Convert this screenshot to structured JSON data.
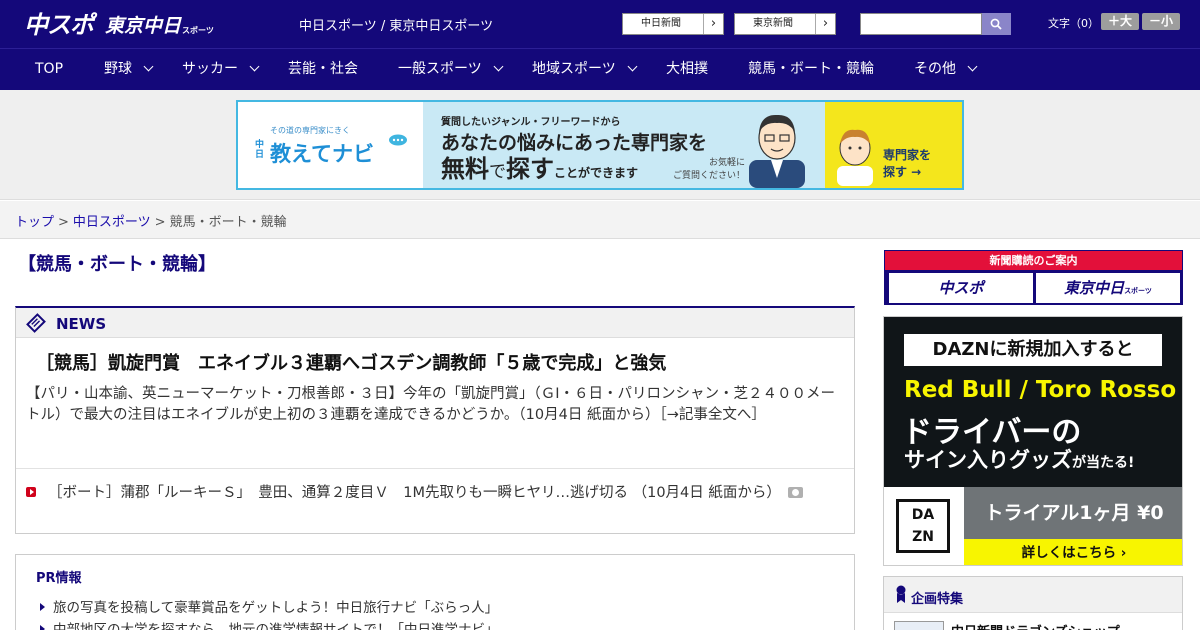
{
  "header": {
    "logo_main": "中スポ",
    "logo_sub": "東京中日",
    "logo_sub_small": "スポーツ",
    "site_title": "中日スポーツ / 東京中日スポーツ",
    "link_buttons": [
      "中日新聞",
      "東京新聞"
    ],
    "link_arrow": "›",
    "search": {
      "placeholder": ""
    },
    "font_size_label": "文字（0）",
    "font_size_buttons": [
      "＋大",
      "－小"
    ]
  },
  "nav": {
    "items": [
      {
        "label": "TOP",
        "dropdown": false
      },
      {
        "label": "野球",
        "dropdown": true
      },
      {
        "label": "サッカー",
        "dropdown": true
      },
      {
        "label": "芸能・社会",
        "dropdown": false
      },
      {
        "label": "一般スポーツ",
        "dropdown": true
      },
      {
        "label": "地域スポーツ",
        "dropdown": true
      },
      {
        "label": "大相撲",
        "dropdown": false
      },
      {
        "label": "競馬・ボート・競輪",
        "dropdown": false
      },
      {
        "label": "その他",
        "dropdown": true
      }
    ]
  },
  "ad_banner": {
    "tagline_small": "その道の専門家にきく",
    "vertical": "中日",
    "brand": "教えてナビ",
    "question": "質問したいジャンル・フリーワードから",
    "headline1": "あなたの悩みにあった専門家を",
    "headline2_a": "無料",
    "headline2_b": "で",
    "headline2_c": "探す",
    "headline2_d": "ことができます",
    "note1": "お気軽に",
    "note2": "ご質問ください！",
    "cta1": "専門家を",
    "cta2": "探す →"
  },
  "breadcrumb": {
    "items": [
      "トップ",
      "中日スポーツ",
      "競馬・ボート・競輪"
    ],
    "sep": ">"
  },
  "page_title": "【競馬・ボート・競輪】",
  "news": {
    "label": "NEWS",
    "top": {
      "headline": "［競馬］凱旋門賞　エネイブル３連覇へゴスデン調教師「５歳で完成」と強気",
      "summary": "【パリ・山本諭、英ニューマーケット・刀根善郎・３日】今年の「凱旋門賞」（ＧⅠ・６日・パリロンシャン・芝２４００メートル）で最大の注目はエネイブルが史上初の３連覇を達成できるかどうか。（10月4日 紙面から）",
      "more": "［→記事全文へ］"
    },
    "items": [
      {
        "text": "［ボート］蒲郡「ルーキーＳ」　豊田、通算２度目Ｖ　1M先取りも一瞬ヒヤリ…逃げ切る （10月4日 紙面から）"
      }
    ]
  },
  "pr": {
    "title": "PR情報",
    "items": [
      "旅の写真を投稿して豪華賞品をゲットしよう！中日旅行ナビ「ぶらっ人」",
      "中部地区の大学を探すなら、地元の進学情報サイトで！「中日進学ナビ」"
    ]
  },
  "sidebar": {
    "subscribe": {
      "title": "新聞購読のご案内",
      "left": "中スポ",
      "right": "東京中日",
      "right_small": "スポーツ"
    },
    "dazn_ad": {
      "line1": "DAZNに新規加入すると",
      "line2": "Red Bull / Toro Rosso",
      "line3": "ドライバーの",
      "line4a": "サイン入りグッズ",
      "line4b": "が当たる!",
      "logo_top": "DA",
      "logo_bottom": "ZN",
      "trial": "トライアル1ヶ月 ¥0",
      "detail": "詳しくはこちら ›"
    },
    "feature": {
      "title": "企画特集",
      "items": [
        "中日新聞ドラゴンズショップ"
      ]
    }
  },
  "colors": {
    "brand_navy": "#14087a",
    "accent_red": "#e3103a",
    "dazn_yellow": "#f8f500",
    "ad_blue": "#44b8e2"
  }
}
